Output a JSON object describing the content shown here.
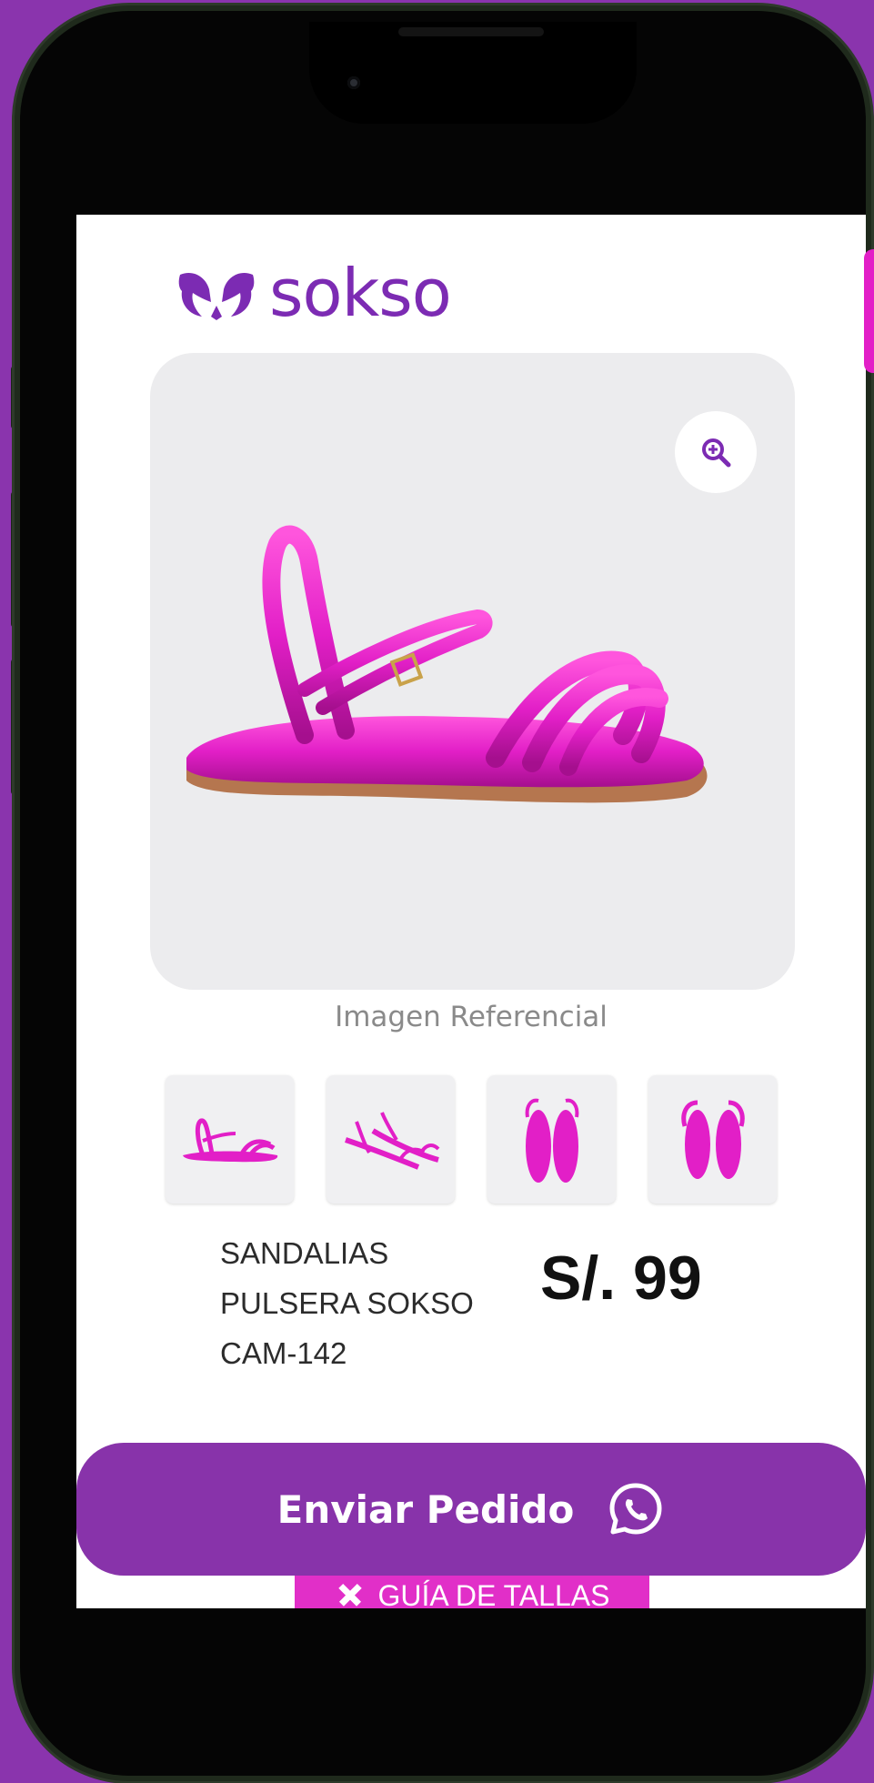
{
  "brand": {
    "name": "sokso"
  },
  "product": {
    "image_caption": "Imagen Referencial",
    "name_lines": [
      "SANDALIAS",
      "PULSERA SOKSO",
      "CAM-142"
    ],
    "price": "S/. 99",
    "color": "#e21fc7"
  },
  "actions": {
    "order_label": "Enviar Pedido",
    "size_guide_label": "GUÍA DE TALLAS"
  },
  "colors": {
    "brand_purple": "#8833aa",
    "accent_pink": "#e12fc8",
    "background": "#8a34ad"
  },
  "icons": [
    "zoom-in-icon",
    "whatsapp-icon",
    "ruler-pencil-icon"
  ]
}
